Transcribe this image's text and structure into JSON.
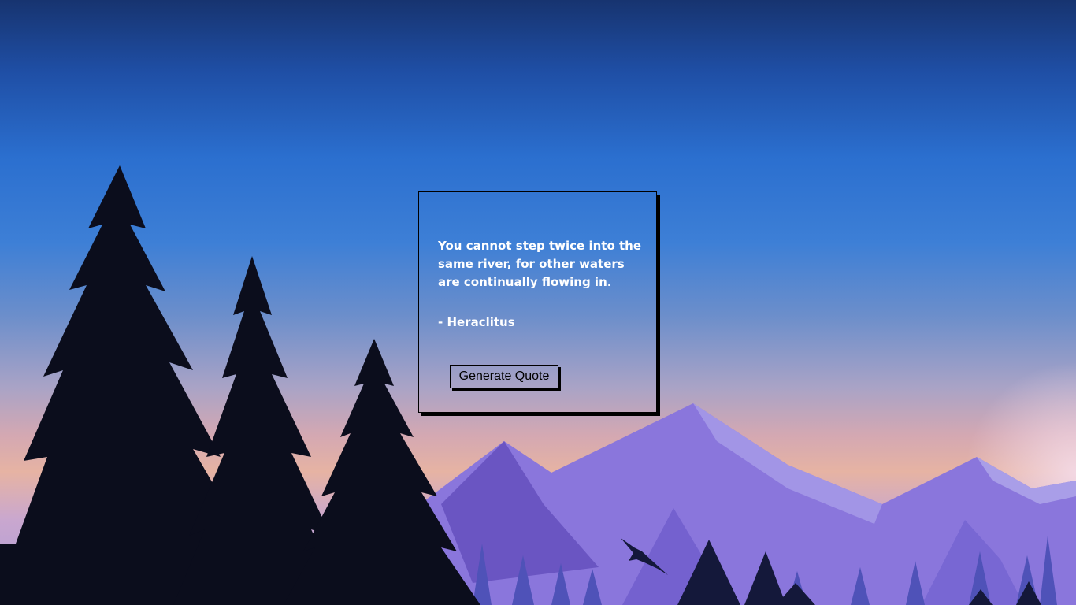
{
  "background": {
    "sky_colors": [
      "#173470",
      "#2b6fcf",
      "#e6b3a3"
    ],
    "mountain_colors": [
      "#6a55c2",
      "#8a76dc",
      "#a295e6"
    ],
    "tree_color": "#0b0d1c"
  },
  "quote_card": {
    "quote": "You cannot step twice into the same river, for other waters are continually flowing in.",
    "author": "- Heraclitus",
    "button_label": "Generate Quote"
  }
}
